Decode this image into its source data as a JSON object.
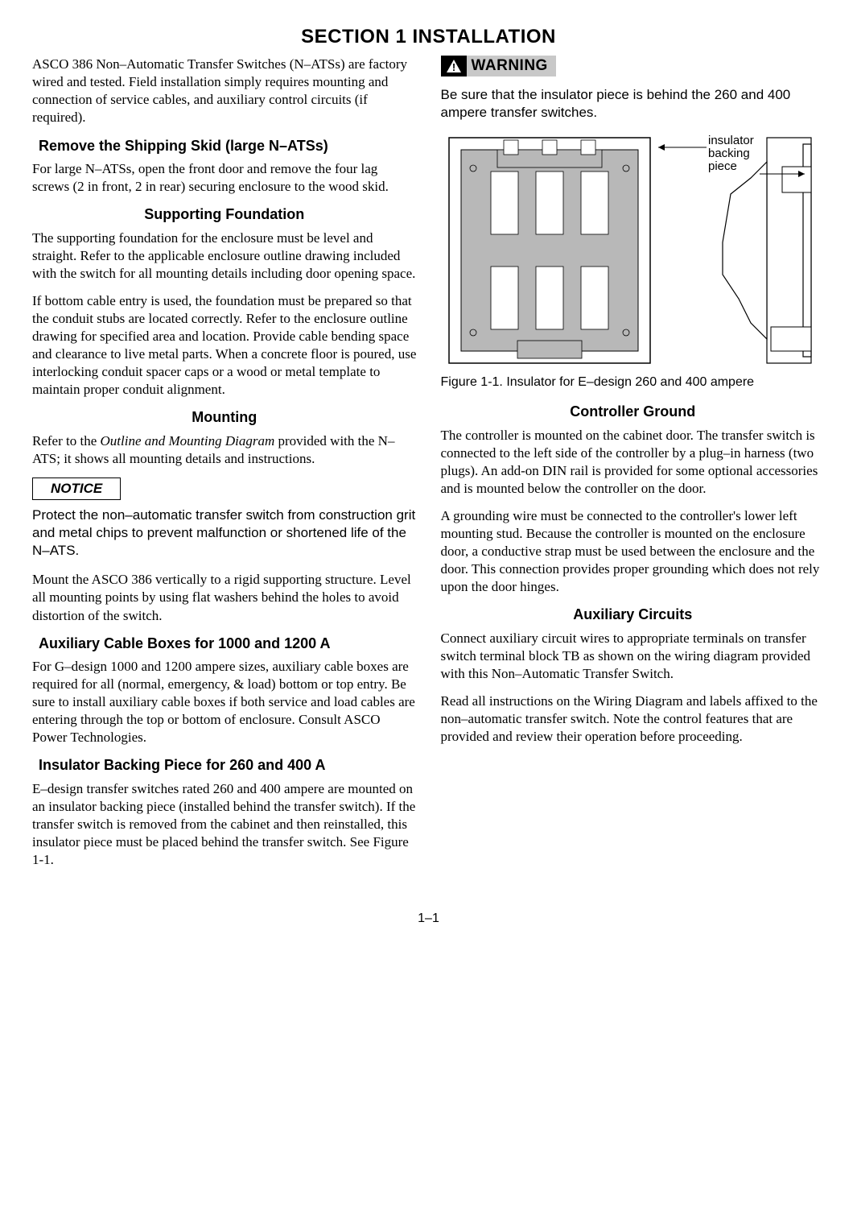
{
  "section_title": "SECTION 1     INSTALLATION",
  "left": {
    "intro": "ASCO 386 Non–Automatic Transfer Switches (N–ATSs) are factory wired and tested. Field installation simply requires mounting and connection of service cables, and auxiliary control circuits (if required).",
    "h_remove": "Remove the Shipping Skid (large N–ATSs)",
    "p_remove": "For large N–ATSs, open the front door and remove the four lag screws (2 in front, 2 in rear) securing enclosure to the wood skid.",
    "h_foundation": "Supporting Foundation",
    "p_found1": "The supporting foundation for the enclosure must be level and straight.  Refer to the applicable enclosure outline drawing included with the switch for all mounting details including door opening space.",
    "p_found2": "If bottom cable entry is used, the foundation must be prepared so that the conduit stubs are located correctly.  Refer to the enclosure outline drawing for specified area and location.  Provide cable bending space and clearance to live metal parts.  When a concrete floor is poured, use interlocking conduit spacer caps or a wood or metal template to maintain proper conduit alignment.",
    "h_mounting": "Mounting",
    "p_mount_pre": "Refer to the ",
    "p_mount_ital": "Outline and Mounting Diagram",
    "p_mount_post": " provided with the N–ATS; it shows all mounting details and instructions.",
    "notice_label": "NOTICE",
    "notice_text": "Protect the non–automatic transfer switch from construction grit and metal chips to prevent malfunction or shortened life of the N–ATS.",
    "p_mount2": "Mount the ASCO 386 vertically to a rigid supporting structure. Level all mounting points by using flat washers behind the holes to avoid distortion of the switch.",
    "h_aux_cable": "Auxiliary Cable Boxes for 1000 and 1200 A",
    "p_aux_cable": "For G–design 1000 and 1200 ampere sizes, auxiliary cable boxes are required for all (normal, emergency, & load) bottom or top entry. Be sure to install auxiliary cable boxes if both service and load cables are entering through the top or bottom of enclosure. Consult ASCO Power Technologies.",
    "h_insulator": "Insulator Backing Piece for 260 and 400 A",
    "p_insulator": "E–design transfer switches rated 260 and 400 ampere are mounted on an insulator backing piece (installed behind the transfer switch).  If the transfer switch is removed from the cabinet and then reinstalled, this insulator piece must be placed behind the transfer switch.  See Figure 1-1."
  },
  "right": {
    "warning_label": "WARNING",
    "warning_text": "Be sure that the insulator piece is behind the 260 and 400 ampere transfer switches.",
    "annot_line1": "insulator",
    "annot_line2": "backing",
    "annot_line3": "piece",
    "fig_caption": "Figure 1-1. Insulator for E–design 260 and 400 ampere",
    "h_controller": "Controller Ground",
    "p_ctrl1": "The controller is mounted on the cabinet door. The transfer switch is connected to the left side of the controller by a plug–in harness (two plugs). An add-on DIN rail is provided for some optional accessories and is mounted below the controller on the door.",
    "p_ctrl2": "A grounding wire must be connected to the controller's lower left mounting stud. Because the controller is mounted on the enclosure door, a conductive strap must be used between the enclosure and the door. This connection provides proper grounding which does not rely upon the door hinges.",
    "h_aux_circ": "Auxiliary Circuits",
    "p_aux1": "Connect auxiliary circuit wires to appropriate terminals on transfer switch terminal block TB as shown on the wiring diagram provided with this Non–Automatic Transfer Switch.",
    "p_aux2": "Read all instructions on the Wiring Diagram and labels affixed to the non–automatic transfer switch.  Note the control features that are provided and review their operation before proceeding."
  },
  "page_number": "1–1"
}
